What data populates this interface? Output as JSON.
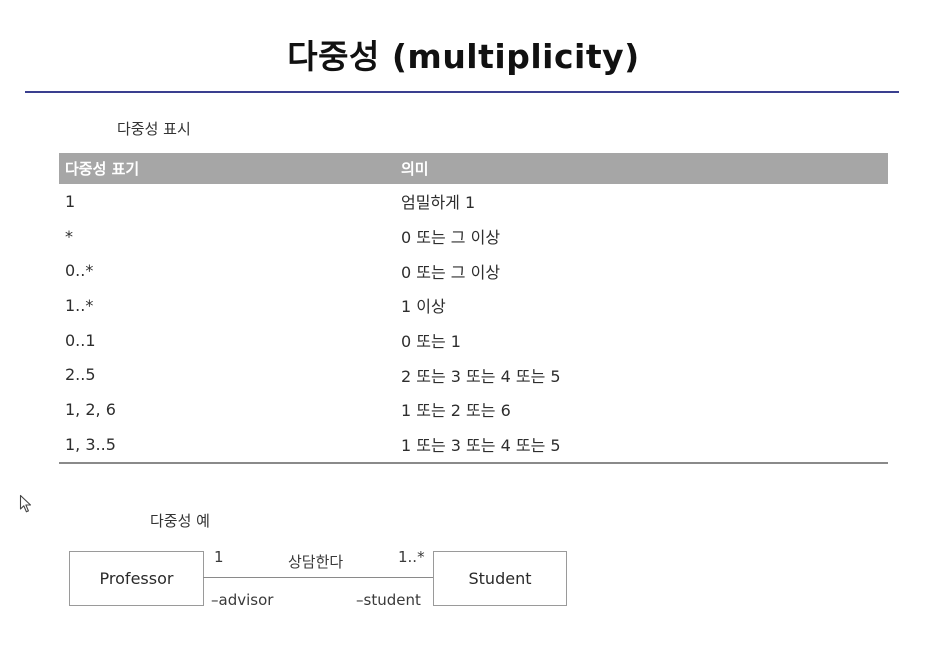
{
  "title": "다중성 (multiplicity)",
  "table_section": {
    "label": "다중성 표시",
    "headers": [
      "다중성 표기",
      "의미"
    ],
    "rows": [
      {
        "notation": "1",
        "meaning": "엄밀하게 1"
      },
      {
        "notation": "*",
        "meaning": "0 또는 그 이상"
      },
      {
        "notation": "0..*",
        "meaning": "0 또는 그 이상"
      },
      {
        "notation": "1..*",
        "meaning": "1 이상"
      },
      {
        "notation": "0..1",
        "meaning": "0 또는 1"
      },
      {
        "notation": "2..5",
        "meaning": "2 또는 3 또는 4 또는 5"
      },
      {
        "notation": "1, 2, 6",
        "meaning": "1 또는 2 또는 6"
      },
      {
        "notation": "1, 3..5",
        "meaning": "1 또는 3 또는 4 또는 5"
      }
    ]
  },
  "example_section": {
    "label": "다중성 예",
    "left_class": "Professor",
    "right_class": "Student",
    "association_name": "상담한다",
    "left_multiplicity": "1",
    "right_multiplicity": "1..*",
    "left_role": "–advisor",
    "right_role": "–student"
  },
  "colors": {
    "title_rule": "#3a3f8f",
    "table_header_bg": "#a6a6a6",
    "table_header_text": "#ffffff"
  },
  "icons": {
    "cursor": "mouse-pointer-icon"
  }
}
